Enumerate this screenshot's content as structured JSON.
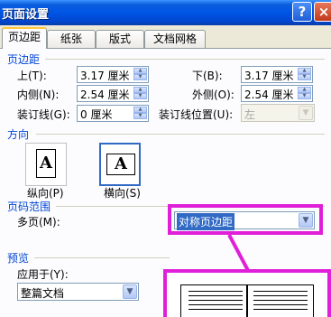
{
  "window": {
    "title": "页面设置",
    "help_label": "?",
    "close_label": "×"
  },
  "tabs": [
    {
      "label": "页边距"
    },
    {
      "label": "纸张"
    },
    {
      "label": "版式"
    },
    {
      "label": "文档网格"
    }
  ],
  "margins": {
    "section_title": "页边距",
    "top": {
      "label": "上(T):",
      "value": "3.17 厘米"
    },
    "bottom": {
      "label": "下(B):",
      "value": "3.17 厘米"
    },
    "inside": {
      "label": "内侧(N):",
      "value": "2.54 厘米"
    },
    "outside": {
      "label": "外侧(O):",
      "value": "2.54 厘米"
    },
    "gutter": {
      "label": "装订线(G):",
      "value": "0 厘米"
    },
    "gutter_position": {
      "label": "装订线位置(U):",
      "value": "左"
    }
  },
  "orientation": {
    "section_title": "方向",
    "portrait": {
      "label": "纵向(P)",
      "glyph": "A"
    },
    "landscape": {
      "label": "横向(S)",
      "glyph": "A"
    }
  },
  "pages": {
    "section_title": "页码范围",
    "multiple_label": "多页(M):",
    "multiple_value": "对称页边距"
  },
  "preview": {
    "section_title": "预览",
    "apply_label": "应用于(Y):",
    "apply_value": "整篇文档"
  },
  "colors": {
    "titlebar": "#0055e5",
    "highlight": "#e020d8",
    "section": "#0046d5"
  }
}
